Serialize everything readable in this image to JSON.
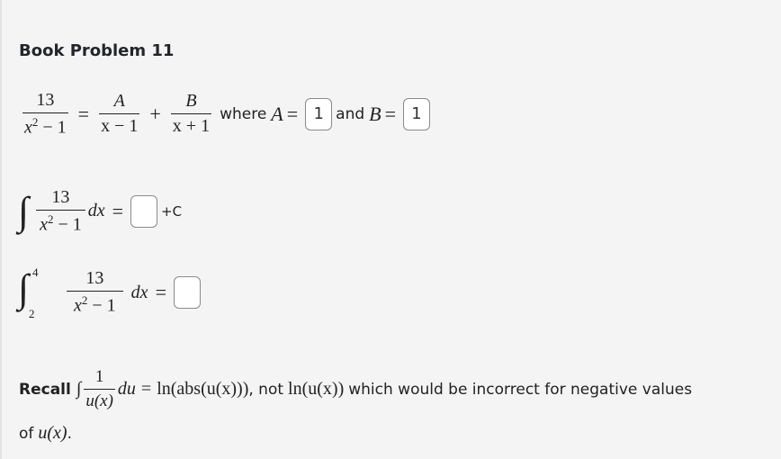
{
  "title": "Book Problem 11",
  "partial_fractions": {
    "lhs_numerator": "13",
    "lhs_denominator_var": "x",
    "lhs_denominator_exp": "2",
    "lhs_denominator_rest": " − 1",
    "equals": "=",
    "term1_numerator": "A",
    "term1_denominator": "x − 1",
    "plus": "+",
    "term2_numerator": "B",
    "term2_denominator": "x + 1",
    "where_text": "where",
    "A_label": "A",
    "and_text": "and",
    "B_label": "B",
    "A_value": "1",
    "B_value": "1"
  },
  "indefinite_integral": {
    "integral_sign": "∫",
    "numerator": "13",
    "denominator_var": "x",
    "denominator_exp": "2",
    "denominator_rest": " − 1",
    "dx": "dx",
    "equals": "=",
    "answer_value": "",
    "constant": "+C"
  },
  "definite_integral": {
    "integral_sign": "∫",
    "upper_limit": "4",
    "lower_limit": "2",
    "numerator": "13",
    "denominator_var": "x",
    "denominator_exp": "2",
    "denominator_rest": " − 1",
    "dx": "dx",
    "equals": "=",
    "answer_value": ""
  },
  "recall": {
    "label": "Recall",
    "integral_sign": "∫",
    "numerator": "1",
    "denominator": "u(x)",
    "du": "du",
    "equals": "=",
    "rhs": "ln(abs(u(x)))",
    "comma_not": ", not",
    "wrong": "ln(u(x))",
    "tail": "which would be incorrect for negative values",
    "line2_prefix": "of",
    "line2_math": "u(x)",
    "line2_end": "."
  }
}
